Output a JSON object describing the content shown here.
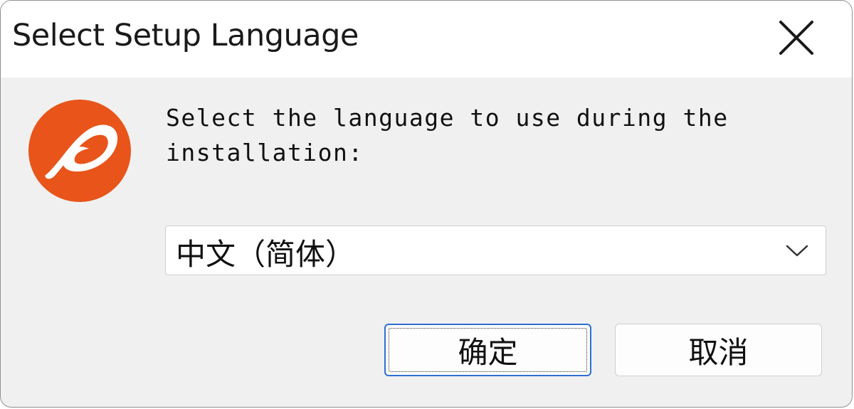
{
  "window": {
    "title": "Select Setup Language"
  },
  "logo": {
    "icon": "app-logo-icon",
    "brand_color": "#e8541a"
  },
  "prompt": {
    "text": "Select the language to use during the installation:"
  },
  "language_select": {
    "selected": "中文（简体）"
  },
  "buttons": {
    "ok_label": "确定",
    "cancel_label": "取消"
  },
  "colors": {
    "accent": "#2f6fd0",
    "dialog_bg": "#f0f0f0"
  }
}
